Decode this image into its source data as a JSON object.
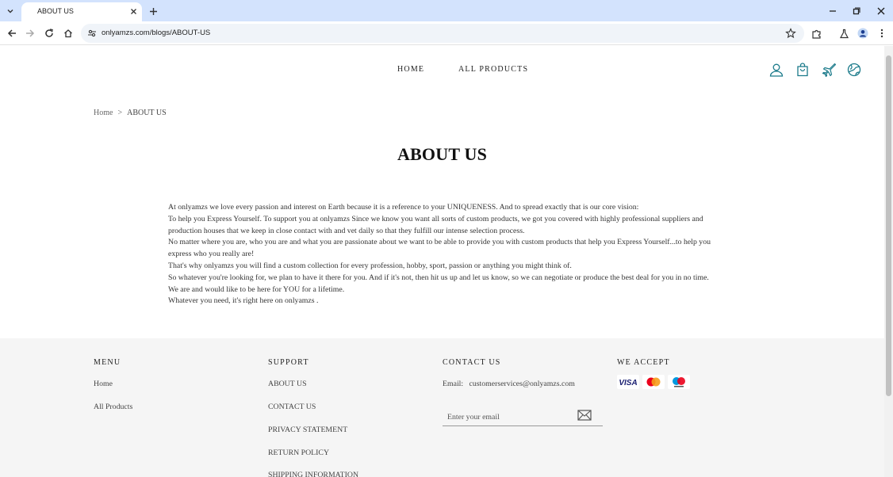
{
  "browser": {
    "tab_title": "ABOUT US",
    "url": "onlyamzs.com/blogs/ABOUT-US"
  },
  "nav": {
    "home": "HOME",
    "all_products": "ALL PRODUCTS"
  },
  "breadcrumb": {
    "home": "Home",
    "separator": ">",
    "current": "ABOUT US"
  },
  "page_title": "ABOUT US",
  "content": {
    "paragraphs": [
      "At onlyamzs we love every passion and interest on Earth because it is a reference to your UNIQUENESS. And to spread exactly that is our core vision:",
      "To help you Express Yourself. To support you at onlyamzs Since we know you want all sorts of custom products, we got you covered with highly professional suppliers and production houses that we keep in close contact with and vet daily so that they fulfill our intense selection process.",
      "No matter where you are, who you are and what you are passionate about we want to be able to provide you with custom products that help you Express Yourself...to help you express who you really are!",
      "That's why onlyamzs you will find a custom collection for every profession, hobby, sport, passion or anything you might think of.",
      "So whatever you're looking for, we plan to have it there for you. And if it's not, then hit us up and let us know, so we can negotiate or produce the best deal for you in no time. We are and would like to be here for YOU for a lifetime.",
      "Whatever you need, it's right here on onlyamzs ."
    ]
  },
  "footer": {
    "menu": {
      "heading": "MENU",
      "links": [
        "Home",
        "All Products"
      ]
    },
    "support": {
      "heading": "SUPPORT",
      "links": [
        "ABOUT US",
        "CONTACT US",
        "PRIVACY STATEMENT",
        "RETURN POLICY",
        "SHIPPING INFORMATION"
      ]
    },
    "contact": {
      "heading": "CONTACT US",
      "email_label": "Email:",
      "email": "customerservices@onlyamzs.com",
      "newsletter_placeholder": "Enter your email"
    },
    "payments": {
      "heading": "WE ACCEPT",
      "visa_text": "VISA",
      "cards": [
        "visa-card",
        "mastercard-card",
        "maestro-card"
      ]
    }
  },
  "colors": {
    "chrome_tabbar": "#d3e3fd",
    "omnibox": "#f0f4f9",
    "accent_icon": "#1a7a8a",
    "footer_bg": "#f5f5f5",
    "visa_blue": "#1a1f71",
    "mc_red": "#eb001b",
    "mc_orange": "#f79e1b",
    "maestro_blue": "#0099df"
  }
}
